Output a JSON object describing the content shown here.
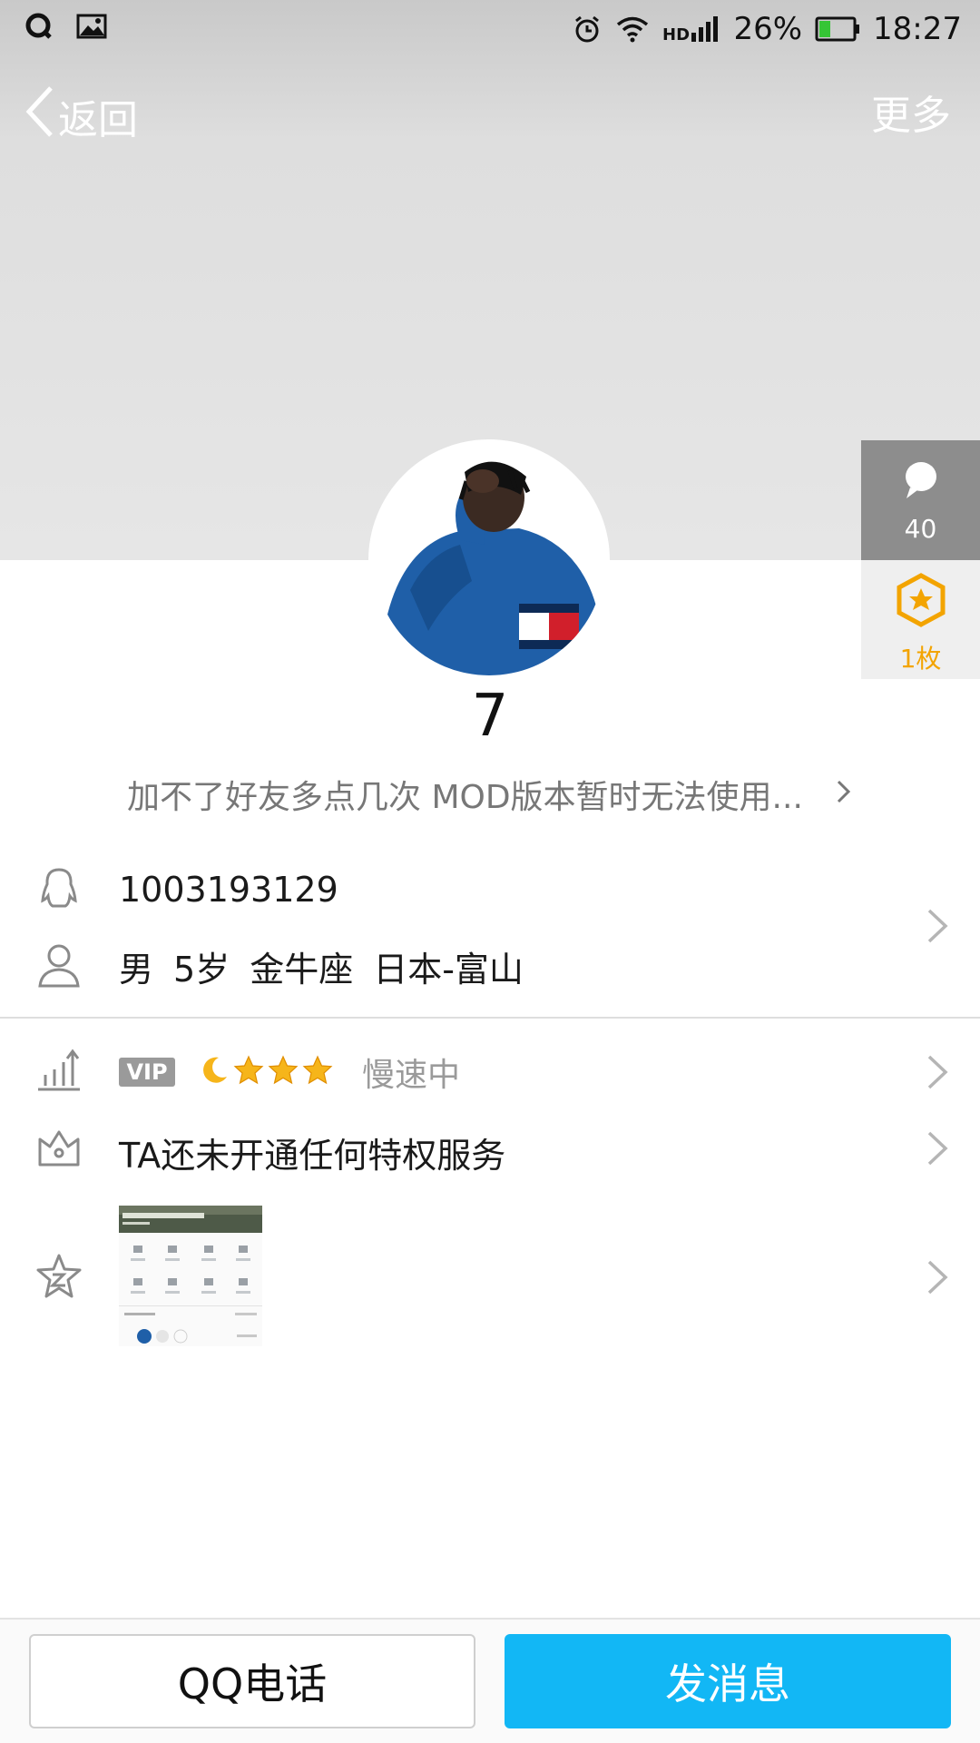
{
  "status_bar": {
    "left_icons": [
      "qq-notification-icon",
      "image-notification-icon"
    ],
    "right_icons": [
      "alarm-icon",
      "wifi-icon",
      "hd-signal-icon",
      "battery-icon"
    ],
    "battery": "26%",
    "time": "18:27"
  },
  "nav": {
    "back_label": "返回",
    "more_label": "更多"
  },
  "profile": {
    "nickname": "7",
    "signature": "加不了好友多点几次 MOD版本暂时无法使用...",
    "likes_count": "40",
    "medal_count": "1枚"
  },
  "info": {
    "qq_number": "1003193129",
    "gender": "男",
    "age": "5岁",
    "zodiac": "金牛座",
    "location": "日本-富山"
  },
  "level": {
    "vip_badge": "VIP",
    "icons": [
      "moon-icon",
      "star-icon",
      "star-icon",
      "star-icon"
    ],
    "status": "慢速中"
  },
  "privilege": {
    "text": "TA还未开通任何特权服务"
  },
  "buttons": {
    "call": "QQ电话",
    "message": "发消息"
  },
  "colors": {
    "accent": "#12b7f5",
    "medal": "#f3a400",
    "cover": "#e3e3e3"
  }
}
